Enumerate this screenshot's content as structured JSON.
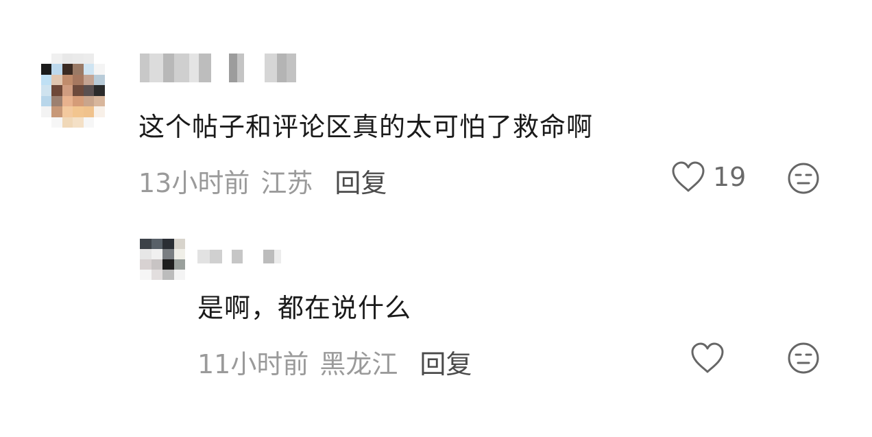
{
  "comments": [
    {
      "text": "这个帖子和评论区真的太可怕了救命啊",
      "time": "13小时前",
      "location": "江苏",
      "reply_label": "回复",
      "like_count": "19",
      "avatar_pixels": [
        "#ffffff",
        "#f0f0f0",
        "#e8e8e8",
        "#eaeaea",
        "#ececec",
        "#ffffff",
        "#ffffff",
        "#1b1b1b",
        "#bcd8ec",
        "#3a2a22",
        "#9a7a66",
        "#cfe4f2",
        "#f4f4f4",
        "#ffffff",
        "#bfe0f4",
        "#e0c6b0",
        "#c08c6c",
        "#a67860",
        "#c4a493",
        "#b8cbd8",
        "#ffffff",
        "#cfe3ef",
        "#6e4838",
        "#cf9c80",
        "#6d4a3c",
        "#5a5050",
        "#2b2b2b",
        "#ffffff",
        "#b8d6ea",
        "#9c8070",
        "#e8b28e",
        "#d59c78",
        "#c9a58c",
        "#d8b69c",
        "#ffffff",
        "#f3f3f3",
        "#c79878",
        "#f3c99e",
        "#f2c58f",
        "#f0c28c",
        "#f8f0e8",
        "#ffffff",
        "#ffffff",
        "#f6f6f6",
        "#f0d8b8",
        "#f4e0c6",
        "#f6f6f6",
        "#ffffff",
        "#ffffff"
      ],
      "username_blocks": [
        {
          "w": 14,
          "c": "#c8c8c8"
        },
        {
          "w": 20,
          "c": "#dcdcdc"
        },
        {
          "w": 16,
          "c": "#b8b8b8"
        },
        {
          "w": 22,
          "c": "#cfcfcf"
        },
        {
          "w": 14,
          "c": "#e4e4e4"
        },
        {
          "w": 18,
          "c": "#bdbdbd"
        },
        {
          "w": 26,
          "c": "#ffffff"
        },
        {
          "w": 12,
          "c": "#9c9c9c"
        },
        {
          "w": 10,
          "c": "#c4c4c4"
        },
        {
          "w": 30,
          "c": "#ffffff"
        },
        {
          "w": 18,
          "c": "#d6d6d6"
        },
        {
          "w": 14,
          "c": "#b4b4b4"
        },
        {
          "w": 14,
          "c": "#c2c2c2"
        }
      ]
    },
    {
      "text": "是啊，都在说什么",
      "time": "11小时前",
      "location": "黑龙江",
      "reply_label": "回复",
      "like_count": "",
      "avatar_pixels": [
        "#3c4248",
        "#586068",
        "#2a2e34",
        "#d8d4cc",
        "#e6e6e6",
        "#f0f0f0",
        "#7a7e82",
        "#f0efe8",
        "#d8d2d2",
        "#c8c4c4",
        "#1e1e1e",
        "#9aa09c",
        "#f6f6f6",
        "#e2dede",
        "#bcbcbc",
        "#f4f4f4"
      ],
      "username_blocks": [
        {
          "w": 18,
          "c": "#e2e2e2"
        },
        {
          "w": 18,
          "c": "#d0d0d0"
        },
        {
          "w": 14,
          "c": "#ffffff"
        },
        {
          "w": 16,
          "c": "#c6c6c6"
        },
        {
          "w": 30,
          "c": "#ffffff"
        },
        {
          "w": 16,
          "c": "#bcbcbc"
        },
        {
          "w": 10,
          "c": "#ececec"
        }
      ]
    }
  ],
  "icons": {
    "like": "heart-outline-icon",
    "emoji": "neutral-face-icon"
  },
  "colors": {
    "text_primary": "#1a1a1a",
    "meta": "#9a9a9a",
    "reply": "#4a4a4a",
    "icon": "#666666"
  }
}
